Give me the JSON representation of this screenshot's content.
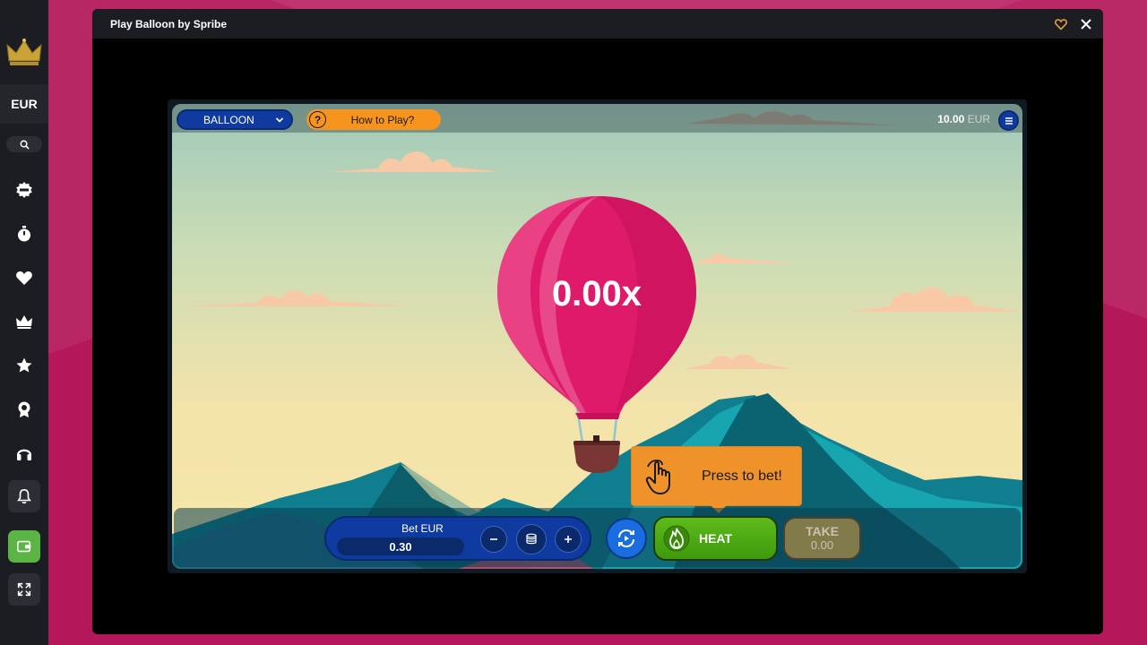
{
  "sidebar": {
    "currency": "EUR"
  },
  "modal": {
    "title": "Play Balloon by Spribe"
  },
  "game": {
    "select_label": "BALLOON",
    "how_to_play": "How to Play?",
    "help_glyph": "?",
    "balance_amount": "10.00",
    "balance_currency": "EUR",
    "multiplier": "0.00x",
    "tooltip_text": "Press to bet!",
    "bet_label": "Bet EUR",
    "bet_value": "0.30",
    "heat_label": "HEAT",
    "take_label": "TAKE",
    "take_value": "0.00"
  },
  "colors": {
    "page_bg": "#b5185a",
    "sidebar_bg": "#1b1d22",
    "wallet_green": "#5bb544",
    "balloon_pink": "#e01a6a",
    "heat_green": "#4caa14",
    "tooltip_orange": "#f0922a",
    "bet_blue": "#0f3aa0"
  }
}
